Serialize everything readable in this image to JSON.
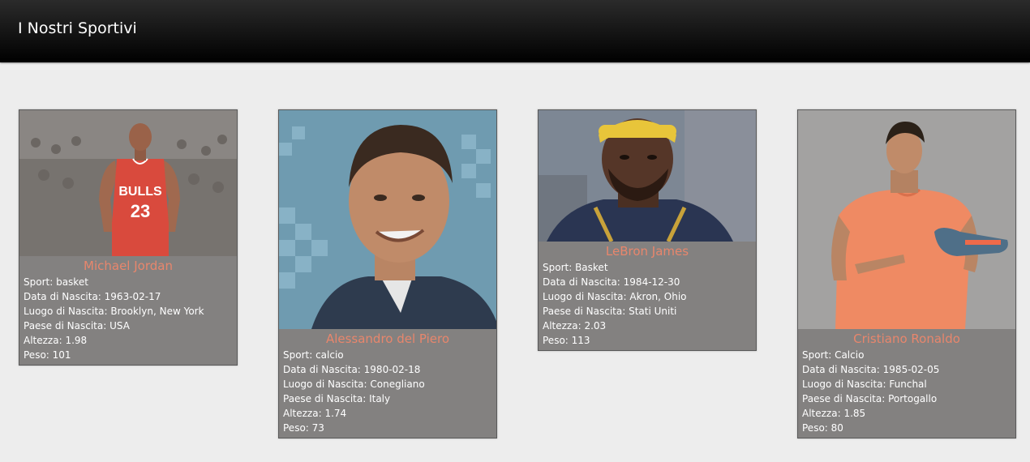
{
  "header": {
    "title": "I Nostri Sportivi"
  },
  "athletes": [
    {
      "name": "Michael Jordan",
      "sport": "Sport: basket",
      "birth_date": "Data di Nascita: 1963-02-17",
      "birth_place": "Luogo di Nascita: Brooklyn, New York",
      "birth_country": "Paese di Nascita: USA",
      "height": "Altezza: 1.98",
      "weight": "Peso: 101"
    },
    {
      "name": "Alessandro del Piero",
      "sport": "Sport: calcio",
      "birth_date": "Data di Nascita: 1980-02-18",
      "birth_place": "Luogo di Nascita: Conegliano",
      "birth_country": "Paese di Nascita: Italy",
      "height": "Altezza: 1.74",
      "weight": "Peso: 73"
    },
    {
      "name": "LeBron James",
      "sport": "Sport: Basket",
      "birth_date": "Data di Nascita: 1984-12-30",
      "birth_place": "Luogo di Nascita: Akron, Ohio",
      "birth_country": "Paese di Nascita: Stati Uniti",
      "height": "Altezza: 2.03",
      "weight": "Peso: 113"
    },
    {
      "name": "Cristiano Ronaldo",
      "sport": "Sport: Calcio",
      "birth_date": "Data di Nascita: 1985-02-05",
      "birth_place": "Luogo di Nascita: Funchal",
      "birth_country": "Paese di Nascita: Portogallo",
      "height": "Altezza: 1.85",
      "weight": "Peso: 80"
    }
  ],
  "jersey": {
    "team": "BULLS",
    "number": "23"
  },
  "colors": {
    "name": "#e8866c",
    "card": "#838180",
    "background": "#ededed"
  }
}
